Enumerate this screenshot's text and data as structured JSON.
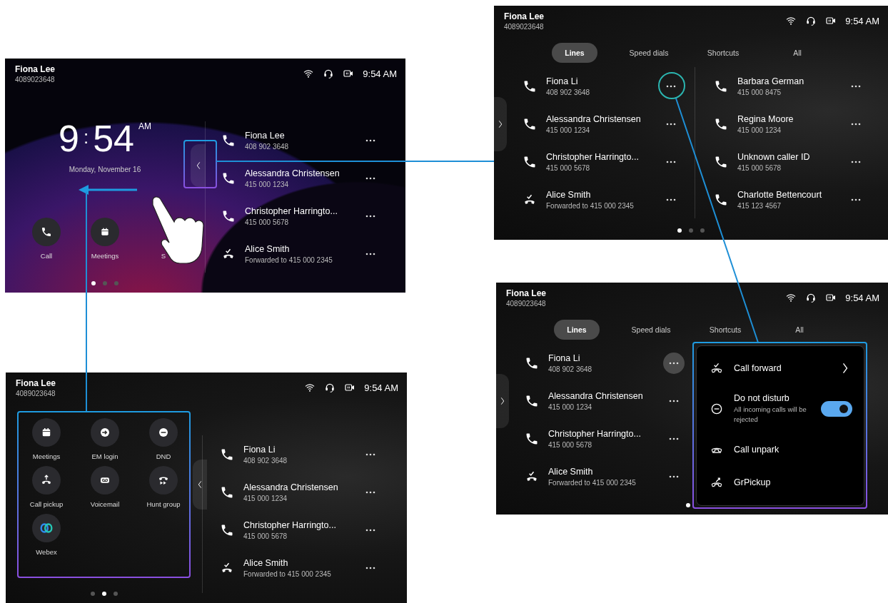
{
  "screens": [
    {
      "kind": "home",
      "user": "Fiona Lee",
      "number": "4089023648",
      "time": "9:54 AM",
      "clock": {
        "hour": "9",
        "separator": ":",
        "minutes": "54",
        "meridiem": "AM"
      },
      "date": "Monday, November 16",
      "quick_actions": [
        {
          "label": "Call"
        },
        {
          "label": "Meetings"
        },
        {
          "label": "S"
        }
      ],
      "lines": [
        {
          "kind": "phone",
          "name": "Fiona Lee",
          "detail": "408 902 3648"
        },
        {
          "kind": "phone",
          "name": "Alessandra Christensen",
          "detail": "415 000 1234"
        },
        {
          "kind": "phone",
          "name": "Christopher Harringto...",
          "detail": "415 000 5678"
        },
        {
          "kind": "forwarded",
          "name": "Alice Smith",
          "detail": "Forwarded to 415 000 2345"
        }
      ],
      "pages": [
        {
          "selected": true
        },
        {
          "selected": false
        },
        {
          "selected": false
        }
      ]
    },
    {
      "kind": "lines",
      "user": "Fiona Lee",
      "number": "4089023648",
      "time": "9:54 AM",
      "tabs": [
        {
          "label": "Lines",
          "selected": true
        },
        {
          "label": "Speed dials",
          "selected": false
        },
        {
          "label": "Shortcuts",
          "selected": false
        },
        {
          "label": "All",
          "selected": false
        }
      ],
      "lines": [
        {
          "kind": "phone",
          "name": "Fiona Li",
          "detail": "408 902 3648"
        },
        {
          "kind": "phone",
          "name": "Alessandra Christensen",
          "detail": "415 000 1234"
        },
        {
          "kind": "phone",
          "name": "Christopher Harringto...",
          "detail": "415 000 5678"
        },
        {
          "kind": "forwarded",
          "name": "Alice Smith",
          "detail": "Forwarded to 415 000 2345"
        }
      ],
      "lines_right": [
        {
          "kind": "phone",
          "name": "Barbara German",
          "detail": "415 000 8475"
        },
        {
          "kind": "phone",
          "name": "Regina Moore",
          "detail": "415 000 1234"
        },
        {
          "kind": "phone",
          "name": "Unknown caller ID",
          "detail": "415 000 5678"
        },
        {
          "kind": "phone",
          "name": "Charlotte Bettencourt",
          "detail": "415 123 4567"
        }
      ],
      "pages": [
        {
          "selected": true
        },
        {
          "selected": false
        },
        {
          "selected": false
        }
      ]
    },
    {
      "kind": "lines_menu",
      "user": "Fiona Lee",
      "number": "4089023648",
      "time": "9:54 AM",
      "tabs": [
        {
          "label": "Lines",
          "selected": true
        },
        {
          "label": "Speed dials",
          "selected": false
        },
        {
          "label": "Shortcuts",
          "selected": false
        },
        {
          "label": "All",
          "selected": false
        }
      ],
      "lines": [
        {
          "kind": "phone",
          "name": "Fiona Li",
          "detail": "408 902 3648",
          "pressed": true
        },
        {
          "kind": "phone",
          "name": "Alessandra Christensen",
          "detail": "415 000 1234",
          "pressed": false
        },
        {
          "kind": "phone",
          "name": "Christopher Harringto...",
          "detail": "415 000 5678",
          "pressed": false
        },
        {
          "kind": "forwarded",
          "name": "Alice Smith",
          "detail": "Forwarded to 415 000 2345",
          "pressed": false
        }
      ],
      "menu": [
        {
          "kind": "submenu",
          "label": "Call forward"
        },
        {
          "kind": "toggle",
          "label": "Do not disturb",
          "description": "All incoming calls will be rejected",
          "on": true
        },
        {
          "kind": "plain",
          "label": "Call unpark"
        },
        {
          "kind": "plain",
          "label": "GrPickup"
        }
      ],
      "pages": [
        {
          "selected": true
        }
      ]
    },
    {
      "kind": "shortcuts",
      "user": "Fiona Lee",
      "number": "4089023648",
      "time": "9:54 AM",
      "shortcuts": [
        {
          "label": "Meetings"
        },
        {
          "label": "EM login"
        },
        {
          "label": "DND"
        },
        {
          "label": "Call pickup"
        },
        {
          "label": "Voicemail"
        },
        {
          "label": "Hunt group"
        },
        {
          "label": "Webex"
        }
      ],
      "lines": [
        {
          "kind": "phone",
          "name": "Fiona Li",
          "detail": "408 902 3648"
        },
        {
          "kind": "phone",
          "name": "Alessandra Christensen",
          "detail": "415 000 1234"
        },
        {
          "kind": "phone",
          "name": "Christopher Harringto...",
          "detail": "415 000 5678"
        },
        {
          "kind": "forwarded",
          "name": "Alice Smith",
          "detail": "Forwarded to 415 000 2345"
        }
      ],
      "pages": [
        {
          "selected": false
        },
        {
          "selected": true
        },
        {
          "selected": false
        }
      ]
    }
  ]
}
